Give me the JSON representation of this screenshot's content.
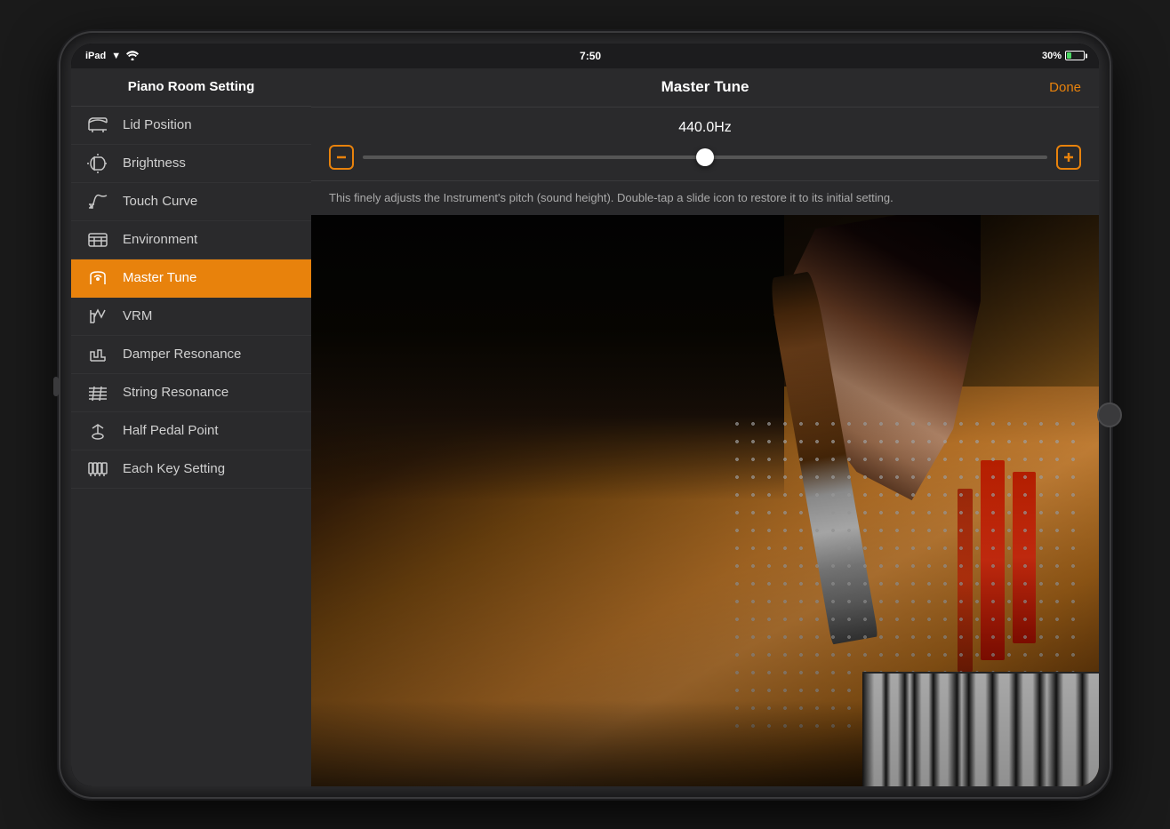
{
  "device": {
    "status_bar": {
      "device_name": "iPad",
      "time": "7:50",
      "battery_percent": "30%"
    }
  },
  "sidebar": {
    "title": "Piano Room Setting",
    "items": [
      {
        "id": "lid-position",
        "label": "Lid Position",
        "icon": "lid-icon"
      },
      {
        "id": "brightness",
        "label": "Brightness",
        "icon": "brightness-icon"
      },
      {
        "id": "touch-curve",
        "label": "Touch Curve",
        "icon": "touch-icon"
      },
      {
        "id": "environment",
        "label": "Environment",
        "icon": "environment-icon"
      },
      {
        "id": "master-tune",
        "label": "Master Tune",
        "icon": "tune-icon",
        "active": true
      },
      {
        "id": "vrm",
        "label": "VRM",
        "icon": "vrm-icon"
      },
      {
        "id": "damper-resonance",
        "label": "Damper Resonance",
        "icon": "damper-icon"
      },
      {
        "id": "string-resonance",
        "label": "String Resonance",
        "icon": "string-icon"
      },
      {
        "id": "half-pedal-point",
        "label": "Half Pedal Point",
        "icon": "pedal-icon"
      },
      {
        "id": "each-key-setting",
        "label": "Each Key Setting",
        "icon": "key-icon"
      }
    ]
  },
  "main_panel": {
    "title": "Master Tune",
    "done_button": "Done",
    "tune_value": "440.0Hz",
    "slider": {
      "min_icon": "minus",
      "max_icon": "plus",
      "position": 50
    },
    "description": "This finely adjusts the Instrument's pitch (sound height). Double-tap a slide icon to restore it to its initial setting."
  }
}
